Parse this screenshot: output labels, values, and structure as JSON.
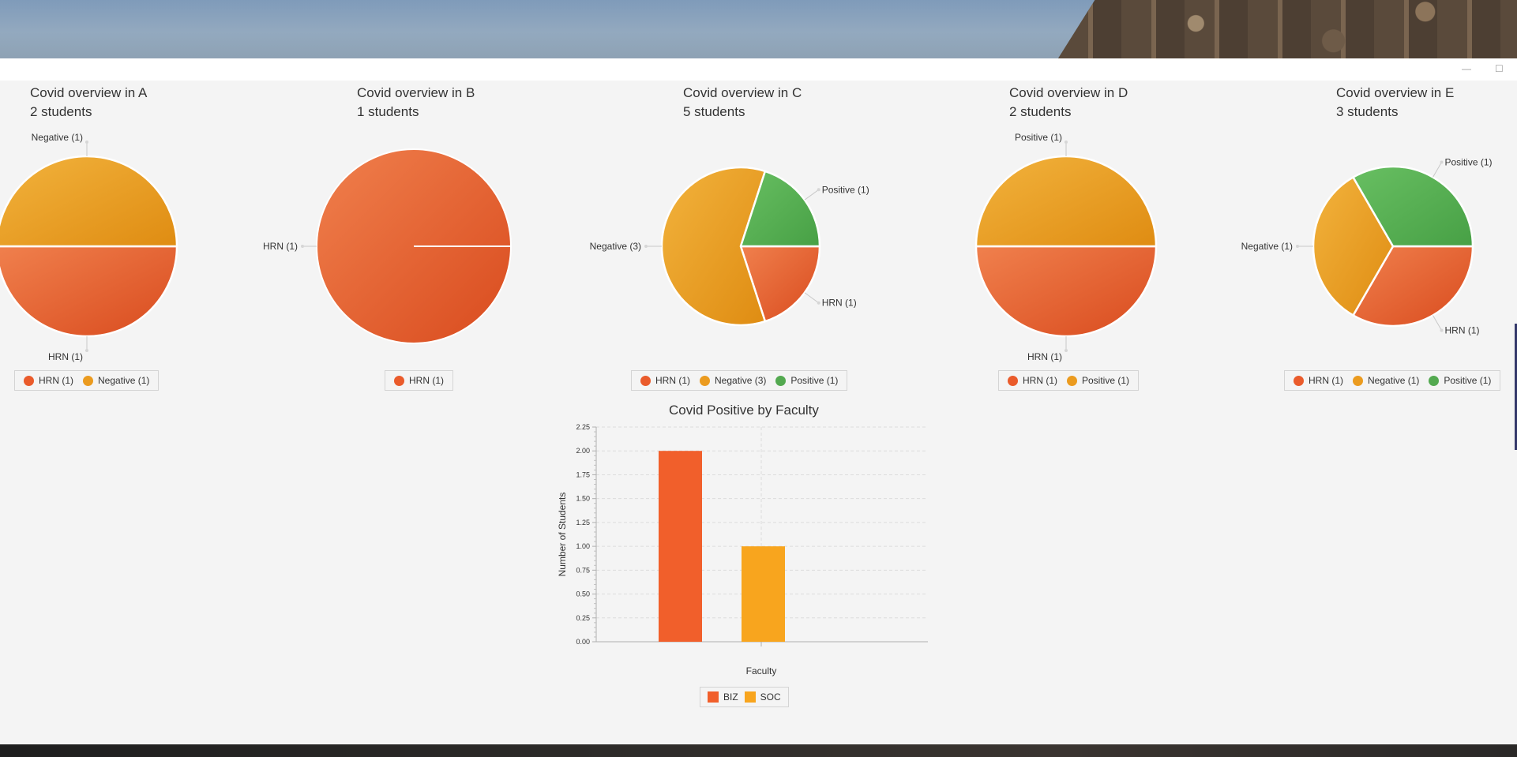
{
  "window": {
    "minimize_glyph": "—",
    "maximize_glyph": "☐"
  },
  "colors": {
    "hrn": "#ea5b2b",
    "negative": "#eb9b1f",
    "positive": "#53a950",
    "biz": "#f15f2b",
    "soc": "#f8a51e"
  },
  "chart_data": [
    {
      "type": "pie",
      "title": "Covid overview in A",
      "subtitle": "2 students",
      "slices": [
        {
          "name": "HRN",
          "label": "HRN (1)",
          "value": 1,
          "color": "#ea5b2b"
        },
        {
          "name": "Negative",
          "label": "Negative (1)",
          "value": 1,
          "color": "#eb9b1f"
        }
      ],
      "legend": [
        "HRN (1)",
        "Negative (1)"
      ]
    },
    {
      "type": "pie",
      "title": "Covid overview in B",
      "subtitle": "1 students",
      "slices": [
        {
          "name": "HRN",
          "label": "HRN (1)",
          "value": 1,
          "color": "#ea5b2b"
        }
      ],
      "legend": [
        "HRN (1)"
      ]
    },
    {
      "type": "pie",
      "title": "Covid overview in C",
      "subtitle": "5 students",
      "slices": [
        {
          "name": "HRN",
          "label": "HRN (1)",
          "value": 1,
          "color": "#ea5b2b"
        },
        {
          "name": "Negative",
          "label": "Negative (3)",
          "value": 3,
          "color": "#eb9b1f"
        },
        {
          "name": "Positive",
          "label": "Positive (1)",
          "value": 1,
          "color": "#53a950"
        }
      ],
      "legend": [
        "HRN (1)",
        "Negative (3)",
        "Positive (1)"
      ]
    },
    {
      "type": "pie",
      "title": "Covid overview in D",
      "subtitle": "2 students",
      "slices": [
        {
          "name": "HRN",
          "label": "HRN (1)",
          "value": 1,
          "color": "#ea5b2b"
        },
        {
          "name": "Positive",
          "label": "Positive (1)",
          "value": 1,
          "color": "#eb9b1f"
        }
      ],
      "legend": [
        "HRN (1)",
        "Positive (1)"
      ]
    },
    {
      "type": "pie",
      "title": "Covid overview in E",
      "subtitle": "3 students",
      "slices": [
        {
          "name": "HRN",
          "label": "HRN (1)",
          "value": 1,
          "color": "#ea5b2b"
        },
        {
          "name": "Negative",
          "label": "Negative (1)",
          "value": 1,
          "color": "#eb9b1f"
        },
        {
          "name": "Positive",
          "label": "Positive (1)",
          "value": 1,
          "color": "#53a950"
        }
      ],
      "legend": [
        "HRN (1)",
        "Negative (1)",
        "Positive (1)"
      ]
    },
    {
      "type": "bar",
      "title": "Covid Positive by Faculty",
      "xlabel": "Faculty",
      "ylabel": "Number of Students",
      "ylim": [
        0,
        2.25
      ],
      "yticks": [
        "0.00",
        "0.25",
        "0.50",
        "0.75",
        "1.00",
        "1.25",
        "1.50",
        "1.75",
        "2.00",
        "2.25"
      ],
      "grid": true,
      "series": [
        {
          "name": "BIZ",
          "values": [
            2
          ],
          "color": "#f15f2b"
        },
        {
          "name": "SOC",
          "values": [
            1
          ],
          "color": "#f8a51e"
        }
      ],
      "legend": [
        "BIZ",
        "SOC"
      ]
    }
  ]
}
